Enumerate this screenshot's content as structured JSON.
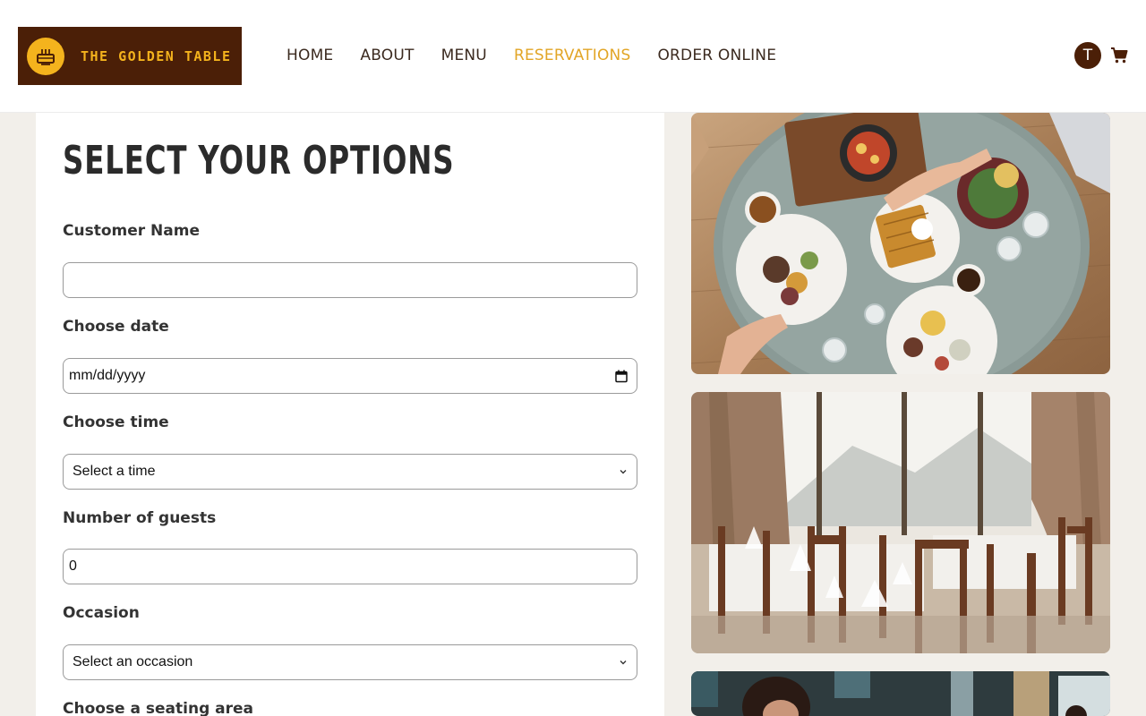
{
  "brand": {
    "name": "THE GOLDEN TABLE",
    "logo_icon": "cake-icon"
  },
  "nav": {
    "items": [
      {
        "label": "HOME",
        "active": false
      },
      {
        "label": "ABOUT",
        "active": false
      },
      {
        "label": "MENU",
        "active": false
      },
      {
        "label": "RESERVATIONS",
        "active": true
      },
      {
        "label": "ORDER ONLINE",
        "active": false
      }
    ],
    "active_color": "#e2a526"
  },
  "header": {
    "avatar_initial": "T",
    "cart_icon": "shopping-cart-icon"
  },
  "form": {
    "title": "SELECT YOUR OPTIONS",
    "customer_name": {
      "label": "Customer Name",
      "value": ""
    },
    "date": {
      "label": "Choose date",
      "placeholder": "mm/dd/yyyy",
      "icon": "calendar-icon"
    },
    "time": {
      "label": "Choose time",
      "selected": "Select a time"
    },
    "guests": {
      "label": "Number of guests",
      "value": "0"
    },
    "occasion": {
      "label": "Occasion",
      "selected": "Select an occasion"
    },
    "seating": {
      "label": "Choose a seating area"
    }
  },
  "colors": {
    "brand_dark": "#4b1f07",
    "brand_gold": "#f4b31d",
    "accent": "#e2a526",
    "background": "#f2efea"
  }
}
